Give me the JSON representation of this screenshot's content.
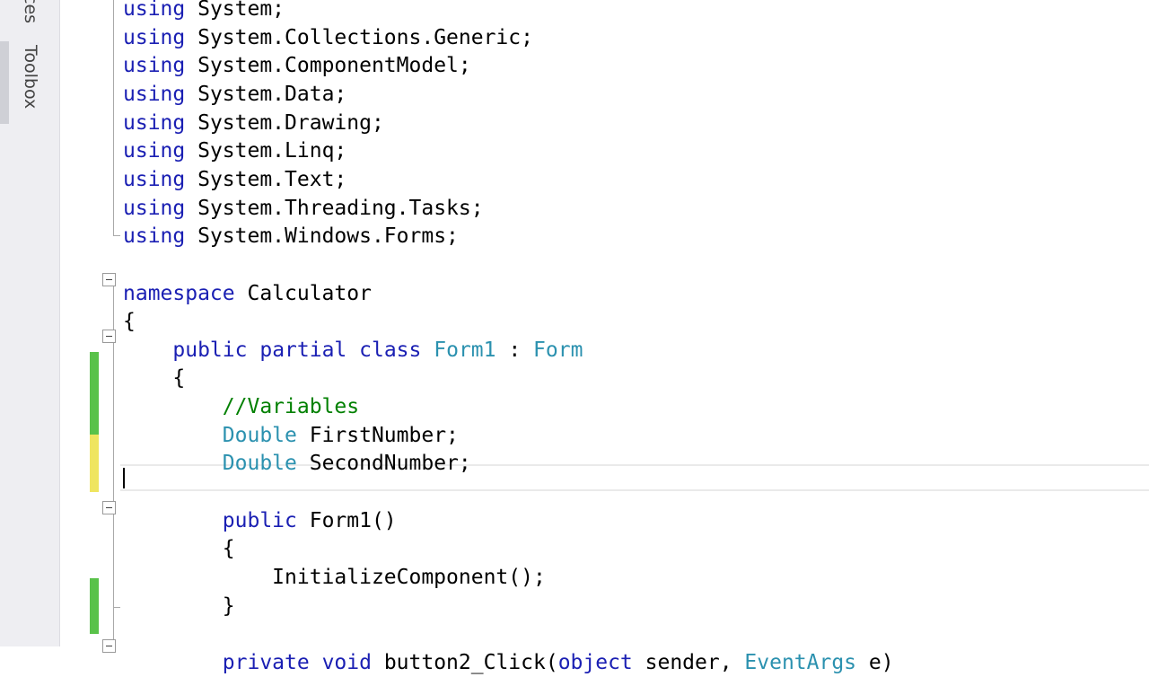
{
  "sidebar": {
    "tabs": [
      {
        "label": "Data Sources",
        "visible_text": "ces"
      },
      {
        "label": "Toolbox"
      }
    ]
  },
  "editor": {
    "lines": [
      {
        "id": "l0",
        "tokens": [
          {
            "t": "using",
            "c": "kw"
          },
          {
            "t": " System;",
            "c": ""
          }
        ]
      },
      {
        "id": "l1",
        "tokens": [
          {
            "t": "using",
            "c": "kw"
          },
          {
            "t": " System.Collections.Generic;",
            "c": ""
          }
        ]
      },
      {
        "id": "l2",
        "tokens": [
          {
            "t": "using",
            "c": "kw"
          },
          {
            "t": " System.ComponentModel;",
            "c": ""
          }
        ]
      },
      {
        "id": "l3",
        "tokens": [
          {
            "t": "using",
            "c": "kw"
          },
          {
            "t": " System.Data;",
            "c": ""
          }
        ]
      },
      {
        "id": "l4",
        "tokens": [
          {
            "t": "using",
            "c": "kw"
          },
          {
            "t": " System.Drawing;",
            "c": ""
          }
        ]
      },
      {
        "id": "l5",
        "tokens": [
          {
            "t": "using",
            "c": "kw"
          },
          {
            "t": " System.Linq;",
            "c": ""
          }
        ]
      },
      {
        "id": "l6",
        "tokens": [
          {
            "t": "using",
            "c": "kw"
          },
          {
            "t": " System.Text;",
            "c": ""
          }
        ]
      },
      {
        "id": "l7",
        "tokens": [
          {
            "t": "using",
            "c": "kw"
          },
          {
            "t": " System.Threading.Tasks;",
            "c": ""
          }
        ]
      },
      {
        "id": "l8",
        "tokens": [
          {
            "t": "using",
            "c": "kw"
          },
          {
            "t": " System.Windows.Forms;",
            "c": ""
          }
        ]
      },
      {
        "id": "l9",
        "tokens": []
      },
      {
        "id": "l10",
        "tokens": [
          {
            "t": "namespace",
            "c": "kw"
          },
          {
            "t": " Calculator",
            "c": ""
          }
        ]
      },
      {
        "id": "l11",
        "tokens": [
          {
            "t": "{",
            "c": ""
          }
        ]
      },
      {
        "id": "l12",
        "tokens": [
          {
            "t": "    ",
            "c": ""
          },
          {
            "t": "public",
            "c": "kw"
          },
          {
            "t": " ",
            "c": ""
          },
          {
            "t": "partial",
            "c": "kw"
          },
          {
            "t": " ",
            "c": ""
          },
          {
            "t": "class",
            "c": "kw"
          },
          {
            "t": " ",
            "c": ""
          },
          {
            "t": "Form1",
            "c": "ty"
          },
          {
            "t": " : ",
            "c": ""
          },
          {
            "t": "Form",
            "c": "ty"
          }
        ]
      },
      {
        "id": "l13",
        "tokens": [
          {
            "t": "    {",
            "c": ""
          }
        ]
      },
      {
        "id": "l14",
        "tokens": [
          {
            "t": "        ",
            "c": ""
          },
          {
            "t": "//Variables",
            "c": "cm"
          }
        ]
      },
      {
        "id": "l15",
        "tokens": [
          {
            "t": "        ",
            "c": ""
          },
          {
            "t": "Double",
            "c": "ty"
          },
          {
            "t": " FirstNumber;",
            "c": ""
          }
        ]
      },
      {
        "id": "l16",
        "tokens": [
          {
            "t": "        ",
            "c": ""
          },
          {
            "t": "Double",
            "c": "ty"
          },
          {
            "t": " SecondNumber;",
            "c": ""
          }
        ]
      },
      {
        "id": "l17",
        "tokens": []
      },
      {
        "id": "l18",
        "tokens": [
          {
            "t": "        ",
            "c": ""
          },
          {
            "t": "public",
            "c": "kw"
          },
          {
            "t": " Form1()",
            "c": ""
          }
        ]
      },
      {
        "id": "l19",
        "tokens": [
          {
            "t": "        {",
            "c": ""
          }
        ]
      },
      {
        "id": "l20",
        "tokens": [
          {
            "t": "            InitializeComponent();",
            "c": ""
          }
        ]
      },
      {
        "id": "l21",
        "tokens": [
          {
            "t": "        }",
            "c": ""
          }
        ]
      },
      {
        "id": "l22",
        "tokens": []
      },
      {
        "id": "l23",
        "tokens": [
          {
            "t": "        ",
            "c": ""
          },
          {
            "t": "private",
            "c": "kw"
          },
          {
            "t": " ",
            "c": ""
          },
          {
            "t": "void",
            "c": "kw"
          },
          {
            "t": " button2_Click(",
            "c": ""
          },
          {
            "t": "object",
            "c": "kw"
          },
          {
            "t": " sender, ",
            "c": ""
          },
          {
            "t": "EventArgs",
            "c": "ty"
          },
          {
            "t": " e)",
            "c": ""
          }
        ]
      }
    ]
  },
  "colors": {
    "keyword": "#1a1fb3",
    "type": "#2b91af",
    "comment": "#008000",
    "saved_change": "#59c24a",
    "unsaved_change": "#efe560"
  }
}
